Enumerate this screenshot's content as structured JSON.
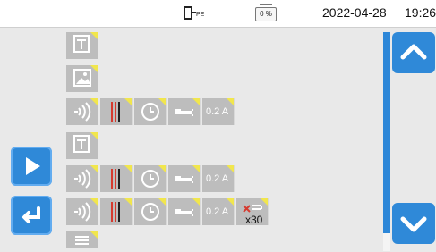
{
  "status": {
    "pe_label": "PE",
    "battery_percent": "0 %",
    "date": "2022-04-28",
    "time": "19:26"
  },
  "rows": [
    {
      "name": "text-row-1",
      "tiles": [
        {
          "icon": "text-icon"
        }
      ]
    },
    {
      "name": "image-row",
      "tiles": [
        {
          "icon": "image-icon"
        }
      ]
    },
    {
      "name": "measure-row-1",
      "tiles": [
        {
          "icon": "wireless-icon"
        },
        {
          "icon": "cable-icon"
        },
        {
          "icon": "clock-icon"
        },
        {
          "icon": "plug-icon"
        },
        {
          "value": "0.2 A"
        }
      ]
    },
    {
      "name": "text-row-2",
      "tiles": [
        {
          "icon": "text-icon"
        }
      ]
    },
    {
      "name": "measure-row-2",
      "tiles": [
        {
          "icon": "wireless-icon"
        },
        {
          "icon": "cable-icon"
        },
        {
          "icon": "clock-icon"
        },
        {
          "icon": "plug-icon"
        },
        {
          "value": "0.2 A"
        }
      ]
    },
    {
      "name": "measure-row-3",
      "tiles": [
        {
          "icon": "wireless-icon"
        },
        {
          "icon": "cable-icon"
        },
        {
          "icon": "clock-icon"
        },
        {
          "icon": "plug-icon"
        },
        {
          "value": "0.2 A"
        },
        {
          "value": "x30",
          "icon": "repeat-icon"
        }
      ]
    },
    {
      "name": "partial-row",
      "tiles": [
        {
          "icon": "partial-icon"
        }
      ]
    }
  ],
  "colors": {
    "accent": "#2f89d8",
    "tile": "#bdbdbd",
    "marker": "#f1e64d"
  }
}
